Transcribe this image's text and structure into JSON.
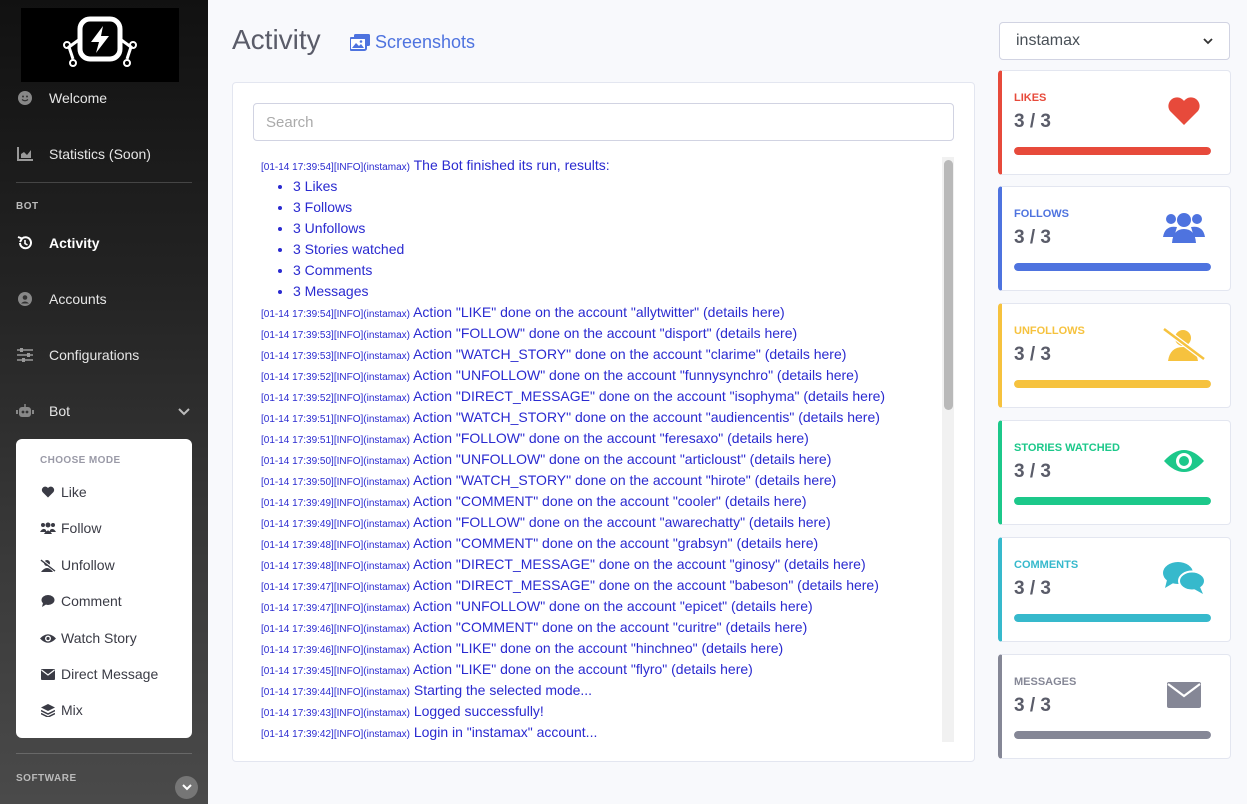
{
  "sidebar": {
    "nav": [
      {
        "label": "Welcome",
        "icon": "smile-icon"
      },
      {
        "label": "Statistics (Soon)",
        "icon": "chart-area-icon"
      }
    ],
    "bot_heading": "BOT",
    "bot_nav": [
      {
        "label": "Activity",
        "icon": "history-icon",
        "active": true
      },
      {
        "label": "Accounts",
        "icon": "user-circle-icon"
      },
      {
        "label": "Configurations",
        "icon": "sliders-icon"
      },
      {
        "label": "Bot",
        "icon": "robot-icon"
      }
    ],
    "mode_panel": {
      "header": "CHOOSE MODE",
      "items": [
        {
          "label": "Like",
          "icon": "heart-icon"
        },
        {
          "label": "Follow",
          "icon": "users-icon"
        },
        {
          "label": "Unfollow",
          "icon": "user-slash-icon"
        },
        {
          "label": "Comment",
          "icon": "comment-icon"
        },
        {
          "label": "Watch Story",
          "icon": "eye-icon"
        },
        {
          "label": "Direct Message",
          "icon": "envelope-icon"
        },
        {
          "label": "Mix",
          "icon": "layers-icon"
        }
      ]
    },
    "software_heading": "SOFTWARE"
  },
  "main": {
    "title": "Activity",
    "screenshots_link": "Screenshots",
    "search_placeholder": "Search",
    "log": {
      "summary_meta": "[01-14 17:39:54][INFO](instamax)",
      "summary_text": "The Bot finished its run, results:",
      "summary_items": [
        "3 Likes",
        "3 Follows",
        "3 Unfollows",
        "3 Stories watched",
        "3 Comments",
        "3 Messages"
      ],
      "lines": [
        {
          "meta": "[01-14 17:39:54][INFO](instamax)",
          "text": "Action \"LIKE\" done on the account \"allytwitter\" (details here)"
        },
        {
          "meta": "[01-14 17:39:53][INFO](instamax)",
          "text": "Action \"FOLLOW\" done on the account \"disport\" (details here)"
        },
        {
          "meta": "[01-14 17:39:53][INFO](instamax)",
          "text": "Action \"WATCH_STORY\" done on the account \"clarime\" (details here)"
        },
        {
          "meta": "[01-14 17:39:52][INFO](instamax)",
          "text": "Action \"UNFOLLOW\" done on the account \"funnysynchro\" (details here)"
        },
        {
          "meta": "[01-14 17:39:52][INFO](instamax)",
          "text": "Action \"DIRECT_MESSAGE\" done on the account \"isophyma\" (details here)"
        },
        {
          "meta": "[01-14 17:39:51][INFO](instamax)",
          "text": "Action \"WATCH_STORY\" done on the account \"audiencentis\" (details here)"
        },
        {
          "meta": "[01-14 17:39:51][INFO](instamax)",
          "text": "Action \"FOLLOW\" done on the account \"feresaxo\" (details here)"
        },
        {
          "meta": "[01-14 17:39:50][INFO](instamax)",
          "text": "Action \"UNFOLLOW\" done on the account \"articloust\" (details here)"
        },
        {
          "meta": "[01-14 17:39:50][INFO](instamax)",
          "text": "Action \"WATCH_STORY\" done on the account \"hirote\" (details here)"
        },
        {
          "meta": "[01-14 17:39:49][INFO](instamax)",
          "text": "Action \"COMMENT\" done on the account \"cooler\" (details here)"
        },
        {
          "meta": "[01-14 17:39:49][INFO](instamax)",
          "text": "Action \"FOLLOW\" done on the account \"awarechatty\" (details here)"
        },
        {
          "meta": "[01-14 17:39:48][INFO](instamax)",
          "text": "Action \"COMMENT\" done on the account \"grabsyn\" (details here)"
        },
        {
          "meta": "[01-14 17:39:48][INFO](instamax)",
          "text": "Action \"DIRECT_MESSAGE\" done on the account \"ginosy\" (details here)"
        },
        {
          "meta": "[01-14 17:39:47][INFO](instamax)",
          "text": "Action \"DIRECT_MESSAGE\" done on the account \"babeson\" (details here)"
        },
        {
          "meta": "[01-14 17:39:47][INFO](instamax)",
          "text": "Action \"UNFOLLOW\" done on the account \"epicet\" (details here)"
        },
        {
          "meta": "[01-14 17:39:46][INFO](instamax)",
          "text": "Action \"COMMENT\" done on the account \"curitre\" (details here)"
        },
        {
          "meta": "[01-14 17:39:46][INFO](instamax)",
          "text": "Action \"LIKE\" done on the account \"hinchneo\" (details here)"
        },
        {
          "meta": "[01-14 17:39:45][INFO](instamax)",
          "text": "Action \"LIKE\" done on the account \"flyro\" (details here)"
        },
        {
          "meta": "[01-14 17:39:44][INFO](instamax)",
          "text": "Starting the selected mode..."
        },
        {
          "meta": "[01-14 17:39:43][INFO](instamax)",
          "text": "Logged successfully!"
        },
        {
          "meta": "[01-14 17:39:42][INFO](instamax)",
          "text": "Login in \"instamax\" account..."
        }
      ]
    }
  },
  "right": {
    "account_select": "instamax",
    "stats": [
      {
        "label": "LIKES",
        "value": "3 / 3",
        "color": "#e74a3b",
        "icon": "heart-icon",
        "progress": 1.0
      },
      {
        "label": "FOLLOWS",
        "value": "3 / 3",
        "color": "#4e73df",
        "icon": "users-icon",
        "progress": 1.0
      },
      {
        "label": "UNFOLLOWS",
        "value": "3 / 3",
        "color": "#f6c23e",
        "icon": "user-slash-icon",
        "progress": 1.0
      },
      {
        "label": "STORIES WATCHED",
        "value": "3 / 3",
        "color": "#1cc88a",
        "icon": "eye-icon",
        "progress": 1.0
      },
      {
        "label": "COMMENTS",
        "value": "3 / 3",
        "color": "#36b9cc",
        "icon": "comments-icon",
        "progress": 1.0
      },
      {
        "label": "MESSAGES",
        "value": "3 / 3",
        "color": "#858796",
        "icon": "envelope-icon",
        "progress": 1.0
      }
    ]
  }
}
